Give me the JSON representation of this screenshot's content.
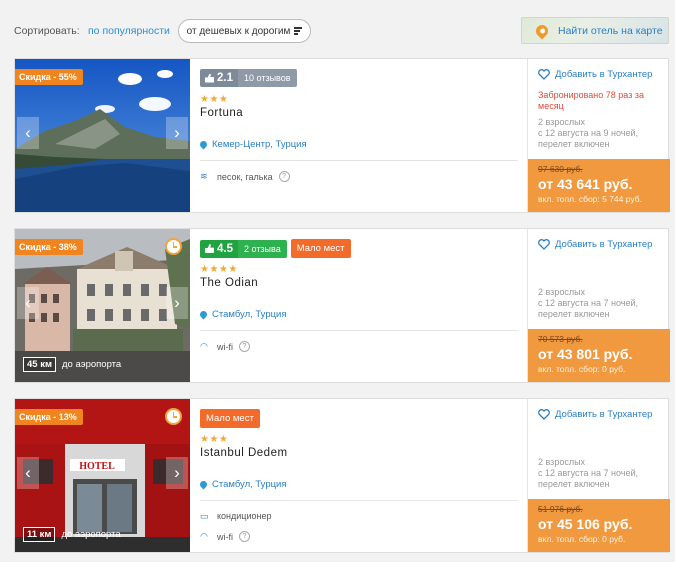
{
  "sort": {
    "label": "Сортировать:",
    "popularity": "по популярности",
    "price_order": "от дешевых к дорогим"
  },
  "map_button": "Найти отель на карте",
  "hotels": [
    {
      "discount": "Скидка - 55%",
      "rating": "2.1",
      "reviews": "10 отзывов",
      "rating_color": "#7c8a99",
      "few_places": "",
      "stars": "★★★",
      "name": "Fortuna",
      "location": "Кемер-Центр, Турция",
      "features": [
        "песок, галька"
      ],
      "add": "Добавить в Турхантер",
      "booked": "Забронировано 78 раз за месяц",
      "pax": "2 взрослых\nс 12 августа на 9 ночей, перелет включен",
      "old_price": "97 630 руб.",
      "price": "от 43 641 руб.",
      "fee": "вкл. топл. сбор: 5 744 руб.",
      "airport_km": "",
      "airport_label": ""
    },
    {
      "discount": "Скидка - 38%",
      "rating": "4.5",
      "reviews": "2 отзыва",
      "rating_color": "#21a341",
      "few_places": "Мало мест",
      "stars": "★★★★",
      "name": "The Odian",
      "location": "Стамбул, Турция",
      "features": [
        "wi-fi"
      ],
      "add": "Добавить в Турхантер",
      "booked": "",
      "pax": "2 взрослых\nс 12 августа на 7 ночей, перелет включен",
      "old_price": "70 573 руб.",
      "price": "от 43 801 руб.",
      "fee": "вкл. топл. сбор: 0 руб.",
      "airport_km": "45 км",
      "airport_label": "до аэропорта"
    },
    {
      "discount": "Скидка - 13%",
      "rating": "",
      "reviews": "",
      "rating_color": "",
      "few_places": "Мало мест",
      "stars": "★★★",
      "name": "Istanbul Dedem",
      "location": "Стамбул, Турция",
      "features": [
        "кондиционер",
        "wi-fi"
      ],
      "add": "Добавить в Турхантер",
      "booked": "",
      "pax": "2 взрослых\nс 12 августа на 7 ночей, перелет включен",
      "old_price": "51 976 руб.",
      "price": "от 45 106 руб.",
      "fee": "вкл. топл. сбор: 0 руб.",
      "airport_km": "11 км",
      "airport_label": "до аэропорта"
    }
  ]
}
